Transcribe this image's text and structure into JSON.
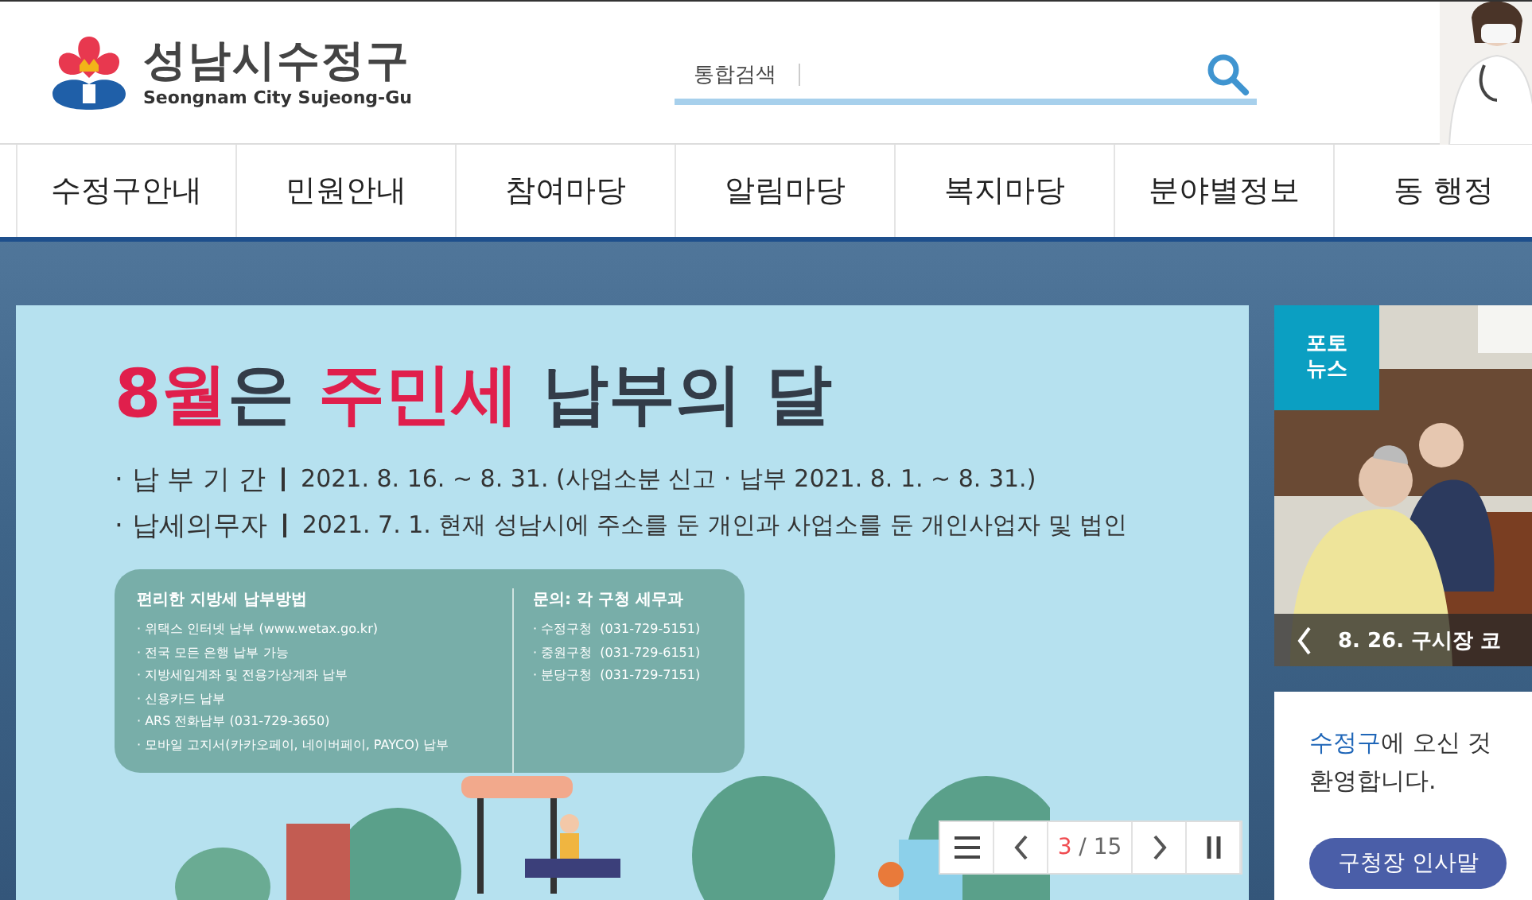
{
  "header": {
    "logo_title": "성남시수정구",
    "logo_subtitle": "Seongnam City Sujeong-Gu",
    "search": {
      "label": "통합검색"
    }
  },
  "nav": [
    "수정구안내",
    "민원안내",
    "참여마당",
    "알림마당",
    "복지마당",
    "분야별정보",
    "동 행정"
  ],
  "banner": {
    "title": [
      {
        "text": "8월",
        "accent": true
      },
      {
        "text": "은 ",
        "accent": false
      },
      {
        "text": "주민세",
        "accent": true
      },
      {
        "text": " 납부의 달",
        "accent": false
      }
    ],
    "facts": [
      {
        "label": "· 납 부 기 간",
        "value": "2021. 8. 16. ~ 8. 31. (사업소분 신고 · 납부 2021. 8. 1. ~ 8. 31.)"
      },
      {
        "label": "· 납세의무자",
        "value": "2021. 7. 1. 현재 성남시에 주소를 둔 개인과 사업소를 둔 개인사업자 및 법인"
      }
    ],
    "methods": {
      "heading": "편리한 지방세 납부방법",
      "items": [
        "· 위택스 인터넷 납부 (www.wetax.go.kr)",
        "· 전국 모든 은행 납부 가능",
        "· 지방세입계좌 및 전용가상계좌 납부",
        "· 신용카드 납부",
        "· ARS 전화납부 (031-729-3650)",
        "· 모바일 고지서(카카오페이, 네이버페이, PAYCO) 납부"
      ]
    },
    "contacts": {
      "heading": "문의: 각 구청 세무과",
      "items": [
        "· 수정구청  (031-729-5151)",
        "· 중원구청  (031-729-6151)",
        "· 분당구청  (031-729-7151)"
      ]
    },
    "pager": {
      "current": "3",
      "total": "/ 15"
    }
  },
  "photo_news": {
    "badge": "포토 뉴스",
    "caption": "8. 26. 구시장 코"
  },
  "welcome": {
    "message": [
      {
        "text": "수정구",
        "accent": true
      },
      {
        "text": "에 오신 것",
        "accent": false
      }
    ],
    "message_line2": "환영합니다.",
    "button": "구청장 인사말"
  }
}
